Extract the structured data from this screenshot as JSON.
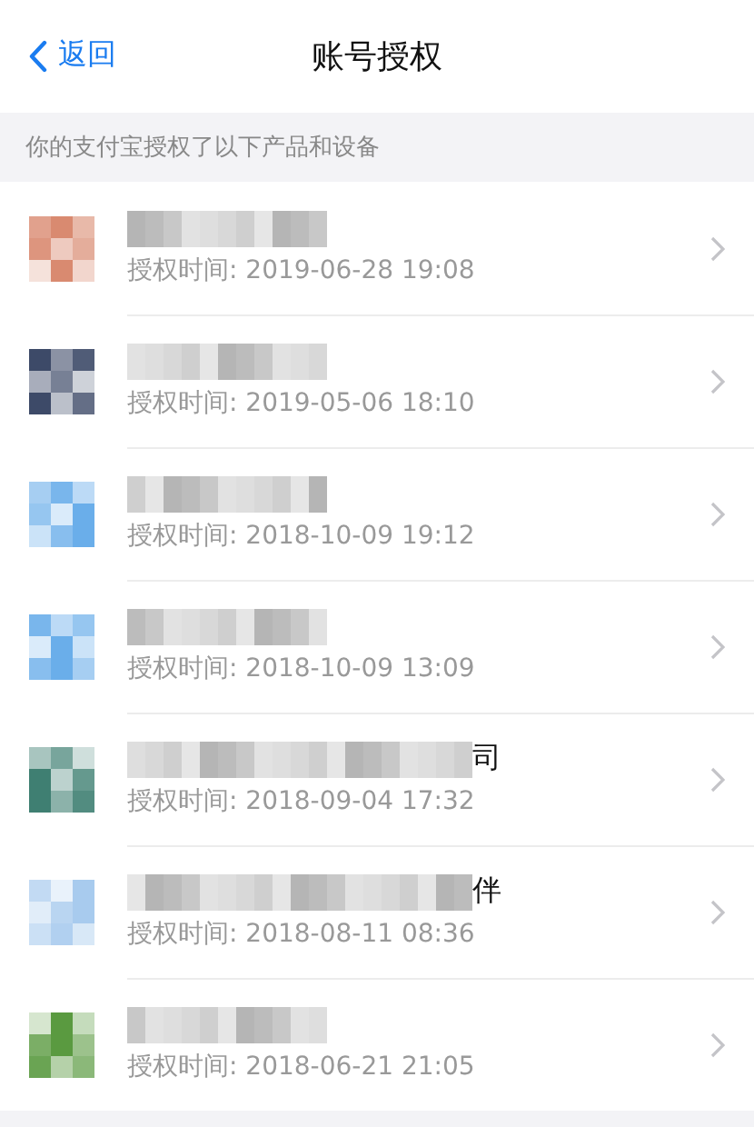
{
  "nav": {
    "back": "返回",
    "title": "账号授权"
  },
  "section_header": "你的支付宝授权了以下产品和设备",
  "items": [
    {
      "color": "#d98a70",
      "time": "授权时间: 2019-06-28 19:08"
    },
    {
      "color": "#3d4a68",
      "time": "授权时间: 2019-05-06 18:10"
    },
    {
      "color": "#6aaeea",
      "time": "授权时间: 2018-10-09 19:12"
    },
    {
      "color": "#6aaeea",
      "time": "授权时间: 2018-10-09 13:09"
    },
    {
      "name_tail": "司",
      "color": "#3f7f72",
      "time": "授权时间: 2018-09-04 17:32"
    },
    {
      "name_tail": "伴",
      "color": "#a8cbee",
      "time": "授权时间: 2018-08-11 08:36"
    },
    {
      "color": "#5a9a40",
      "time": "授权时间: 2018-06-21 21:05"
    }
  ]
}
